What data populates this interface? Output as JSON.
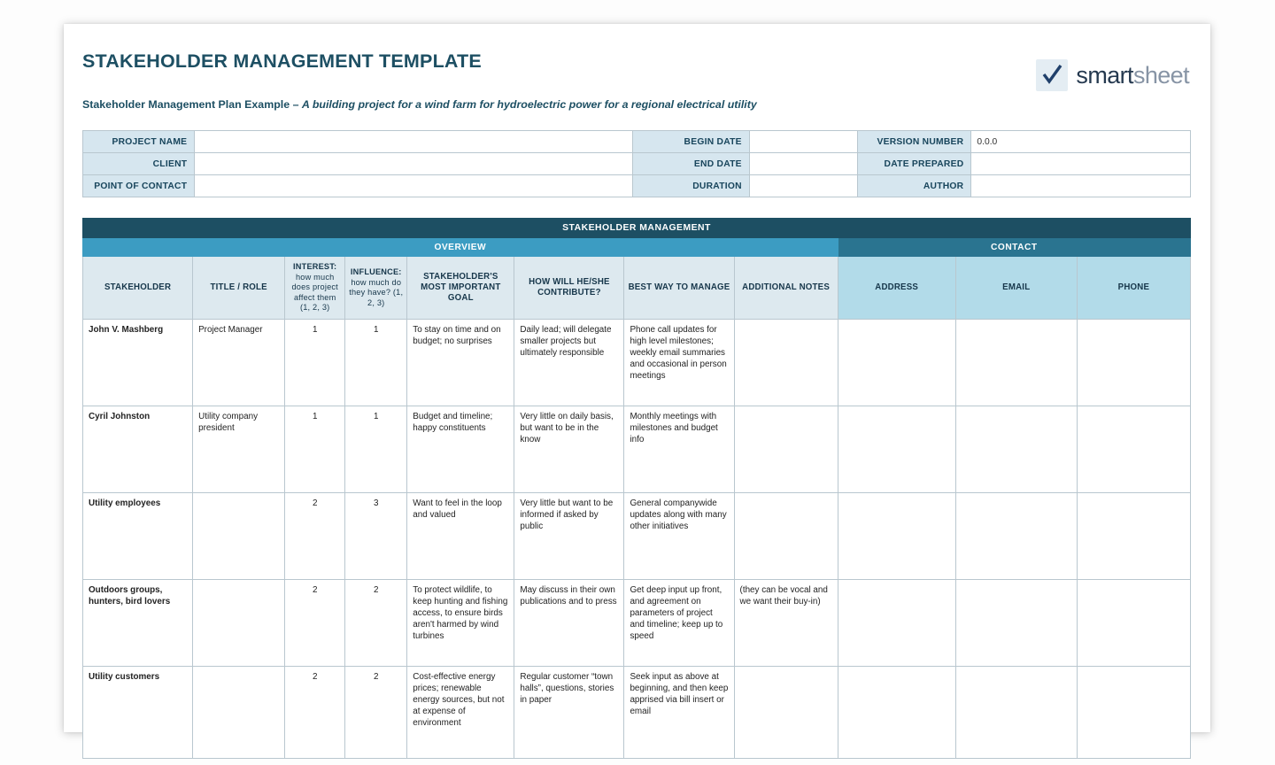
{
  "document": {
    "title": "STAKEHOLDER MANAGEMENT TEMPLATE",
    "subtitle_lead": "Stakeholder Management Plan Example – ",
    "subtitle_italic": "A building project for a wind farm for hydroelectric power for a regional electrical utility"
  },
  "logo": {
    "icon": "checkmark-icon",
    "word_primary": "smart",
    "word_secondary": "sheet"
  },
  "colors": {
    "dark_teal": "#1d4f63",
    "overview_blue": "#3c9cc2",
    "contact_blue": "#2a7490",
    "header_fill": "#dde9ef",
    "contact_header_fill": "#b2dbe9",
    "info_label_fill": "#d6e6ef",
    "border": "#b9c7cf",
    "title_text": "#1d4f63"
  },
  "info": {
    "rows": [
      {
        "label_a": "PROJECT NAME",
        "value_a": "",
        "label_b": "BEGIN DATE",
        "value_b": "",
        "label_c": "VERSION NUMBER",
        "value_c": "0.0.0"
      },
      {
        "label_a": "CLIENT",
        "value_a": "",
        "label_b": "END DATE",
        "value_b": "",
        "label_c": "DATE PREPARED",
        "value_c": ""
      },
      {
        "label_a": "POINT OF CONTACT",
        "value_a": "",
        "label_b": "DURATION",
        "value_b": "",
        "label_c": "AUTHOR",
        "value_c": ""
      }
    ]
  },
  "table": {
    "band_title": "STAKEHOLDER MANAGEMENT",
    "group_overview": "OVERVIEW",
    "group_contact": "CONTACT",
    "columns": {
      "stakeholder": "STAKEHOLDER",
      "title_role": "TITLE / ROLE",
      "interest_main": "INTEREST:",
      "interest_sub": "how much does project affect them (1, 2, 3)",
      "influence_main": "INFLUENCE:",
      "influence_sub": "how much do they have? (1, 2, 3)",
      "goal": "STAKEHOLDER'S MOST IMPORTANT GOAL",
      "contribute": "HOW WILL HE/SHE CONTRIBUTE?",
      "manage": "BEST WAY TO MANAGE",
      "notes": "ADDITIONAL NOTES",
      "address": "ADDRESS",
      "email": "EMAIL",
      "phone": "PHONE"
    },
    "rows": [
      {
        "stakeholder": "John V. Mashberg",
        "title_role": "Project Manager",
        "interest": "1",
        "influence": "1",
        "goal": "To stay on time and on budget; no surprises",
        "contribute": "Daily lead; will delegate smaller projects but ultimately responsible",
        "manage": "Phone call updates for high level milestones; weekly email summaries and occasional in person meetings",
        "notes": "",
        "address": "",
        "email": "",
        "phone": ""
      },
      {
        "stakeholder": "Cyril Johnston",
        "title_role": "Utility company president",
        "interest": "1",
        "influence": "1",
        "goal": "Budget and timeline; happy constituents",
        "contribute": "Very little on daily basis, but want to be in the know",
        "manage": "Monthly meetings with milestones and budget info",
        "notes": "",
        "address": "",
        "email": "",
        "phone": ""
      },
      {
        "stakeholder": "Utility employees",
        "title_role": "",
        "interest": "2",
        "influence": "3",
        "goal": "Want to feel in the loop and valued",
        "contribute": "Very little but want to be informed if asked by public",
        "manage": "General companywide updates along with many other initiatives",
        "notes": "",
        "address": "",
        "email": "",
        "phone": ""
      },
      {
        "stakeholder": "Outdoors groups, hunters, bird lovers",
        "title_role": "",
        "interest": "2",
        "influence": "2",
        "goal": "To protect wildlife, to keep hunting and fishing access, to ensure birds aren't harmed by wind turbines",
        "contribute": "May discuss in their own publications and to press",
        "manage": "Get deep input up front, and agreement on parameters of project and timeline; keep up to speed",
        "notes": "(they can be vocal and we want their buy-in)",
        "address": "",
        "email": "",
        "phone": ""
      },
      {
        "stakeholder": "Utility customers",
        "title_role": "",
        "interest": "2",
        "influence": "2",
        "goal": "Cost-effective energy prices; renewable energy sources, but not at expense of environment",
        "contribute": "Regular customer “town halls”, questions, stories in paper",
        "manage": "Seek input as above at beginning, and then keep apprised via bill insert or email",
        "notes": "",
        "address": "",
        "email": "",
        "phone": ""
      }
    ]
  }
}
